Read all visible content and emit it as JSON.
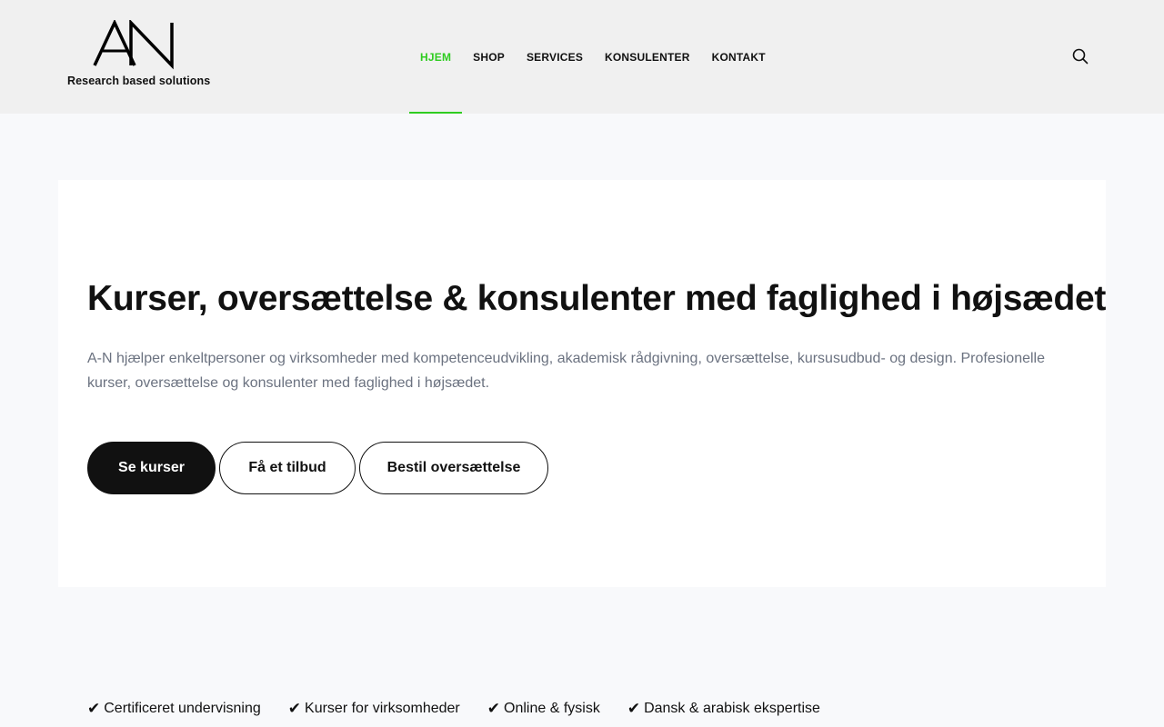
{
  "header": {
    "logo_text": "AN",
    "tagline": "Research based solutions",
    "nav": [
      {
        "label": "HJEM"
      },
      {
        "label": "SHOP"
      },
      {
        "label": "SERVICES"
      },
      {
        "label": "KONSULENTER"
      },
      {
        "label": "KONTAKT"
      }
    ],
    "active_nav": "HJEM",
    "search_icon": "search-icon"
  },
  "hero": {
    "title": "Kurser, oversættelse & konsulenter med faglighed i højsædet",
    "description": "A-N hjælper enkeltpersoner og virksomheder med kompetenceudvikling, akademisk rådgivning, oversættelse, kursusudbud- og design. Profesionelle kurser, oversættelse og konsulenter med faglighed i højsædet.",
    "buttons": {
      "primary": "Se kurser",
      "offer": "Få et tilbud",
      "translate": "Bestil oversættelse"
    }
  },
  "features": [
    {
      "check": "✔",
      "label": "Certificeret undervisning"
    },
    {
      "check": "✔",
      "label": "Kurser for virksomheder"
    },
    {
      "check": "✔",
      "label": "Online & fysisk"
    },
    {
      "check": "✔",
      "label": "Dansk & arabisk ekspertise"
    }
  ],
  "colors": {
    "accent": "#2ecc20",
    "header_bg": "#f0f0f0",
    "page_bg": "#f8f9fb",
    "primary_button": "#111111",
    "body_text": "#6b7280"
  }
}
